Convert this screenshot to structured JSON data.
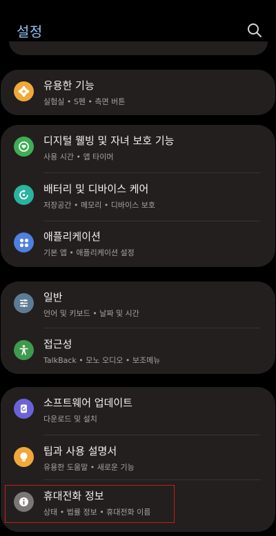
{
  "header": {
    "title": "설정",
    "search_icon": "search-icon"
  },
  "cards": [
    {
      "items": [
        {
          "title": "유용한 기능",
          "subtitle": "실험실 • S펜 • 측면 버튼",
          "icon": "gear-plus-icon",
          "icon_color": "#f0a83a"
        }
      ]
    },
    {
      "items": [
        {
          "title": "디지털 웰빙 및 자녀 보호 기능",
          "subtitle": "사용 시간 • 앱 타이머",
          "icon": "heart-ring-icon",
          "icon_color": "#3fae55"
        },
        {
          "title": "배터리 및 디바이스 케어",
          "subtitle": "저장공간 • 메모리 • 디바이스 보호",
          "icon": "refresh-ring-icon",
          "icon_color": "#2bb3a0"
        },
        {
          "title": "애플리케이션",
          "subtitle": "기본 앱 • 애플리케이션 설정",
          "icon": "apps-grid-icon",
          "icon_color": "#4f7fe0"
        }
      ]
    },
    {
      "items": [
        {
          "title": "일반",
          "subtitle": "언어 및 키보드 • 날짜 및 시간",
          "icon": "sliders-icon",
          "icon_color": "#5e7b95"
        },
        {
          "title": "접근성",
          "subtitle": "TalkBack • 모노 오디오 • 보조메뉴",
          "icon": "accessibility-person-icon",
          "icon_color": "#3e9a4c"
        }
      ]
    },
    {
      "items": [
        {
          "title": "소프트웨어 업데이트",
          "subtitle": "다운로드 및 설치",
          "icon": "update-icon",
          "icon_color": "#6a63d8"
        },
        {
          "title": "팁과 사용 설명서",
          "subtitle": "유용한 도움말 • 새로운 기능",
          "icon": "lightbulb-icon",
          "icon_color": "#f0a83a"
        },
        {
          "title": "휴대전화 정보",
          "subtitle": "상태 • 법률 정보 • 휴대전화 이름",
          "icon": "info-icon",
          "icon_color": "#7a7776"
        }
      ]
    }
  ],
  "colors": {
    "background": "#000000",
    "card": "#231f1e",
    "title": "#8fc4f2",
    "highlight": "#c01f1f"
  }
}
